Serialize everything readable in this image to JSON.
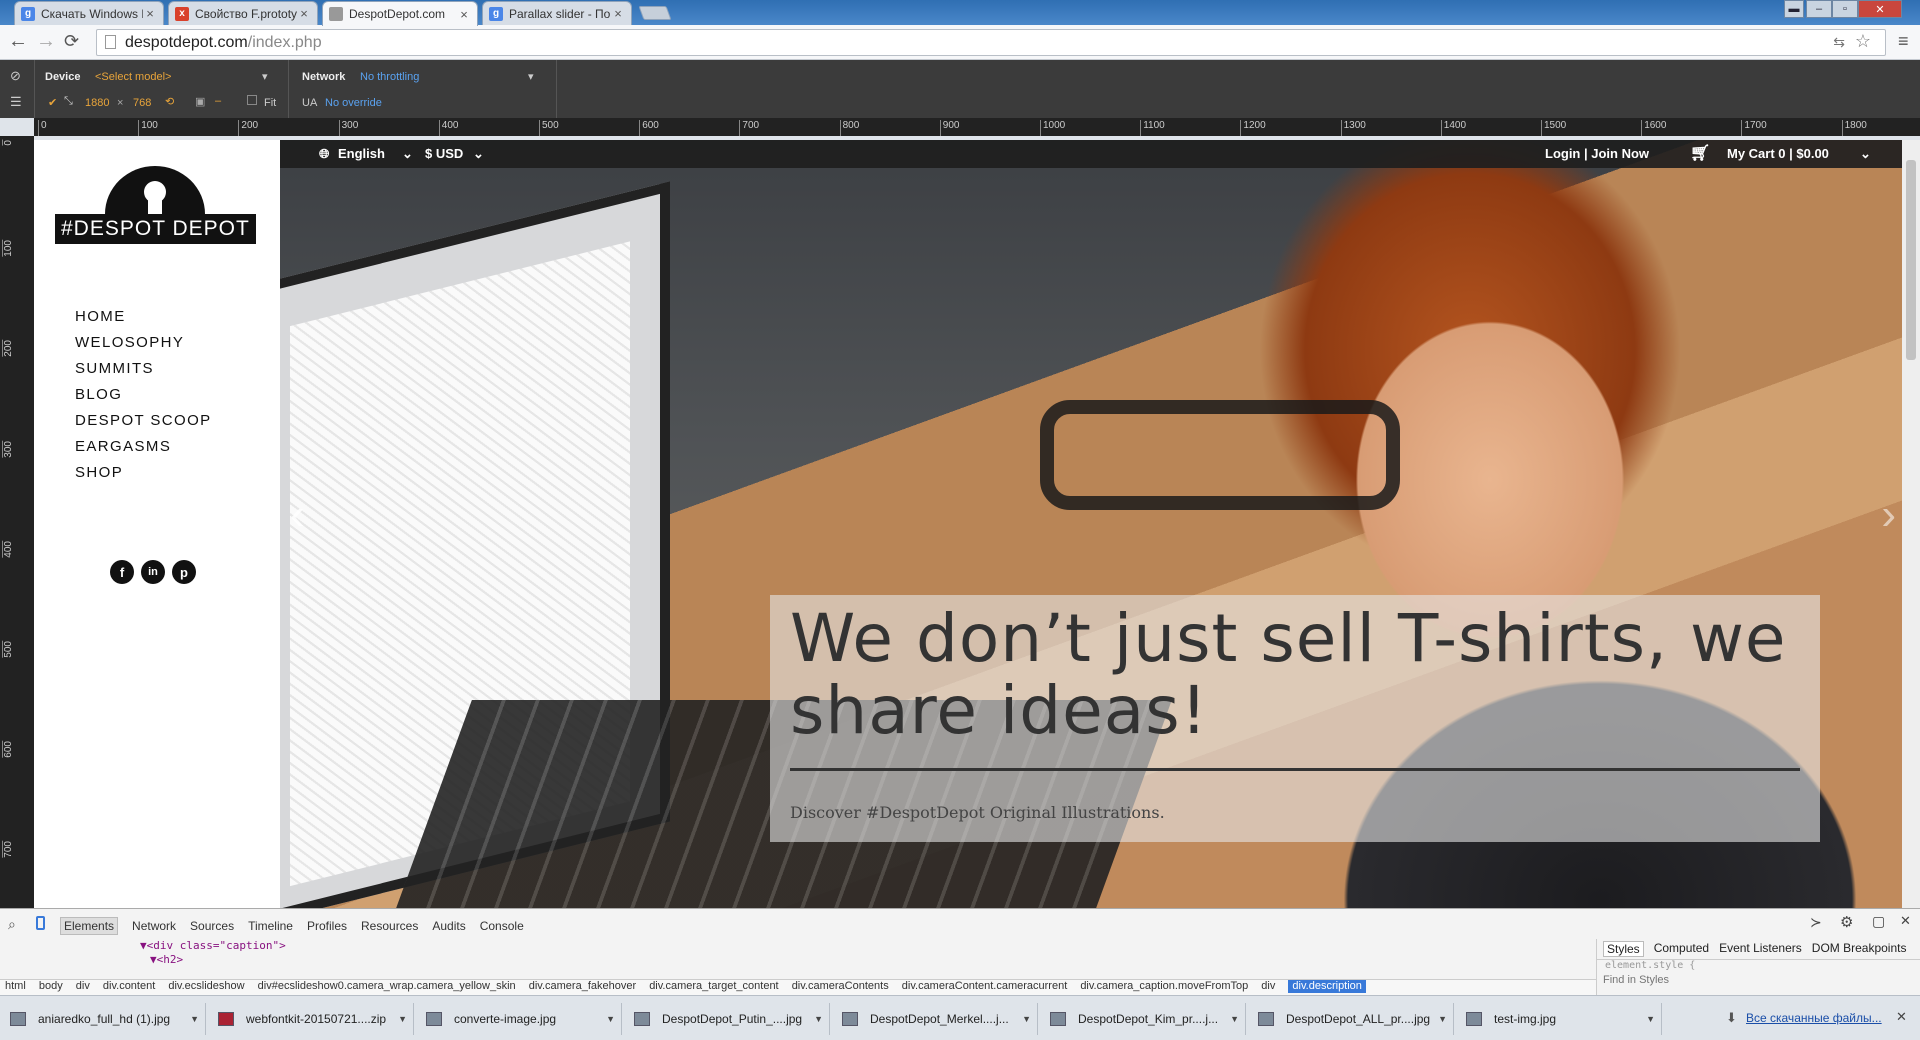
{
  "browser": {
    "tabs": [
      {
        "title": "Скачать Windows Phone",
        "icon": "google-icon",
        "color": "#4a86e8"
      },
      {
        "title": "Свойство F.prototype и с",
        "icon": "js-icon",
        "color": "#d9412b"
      },
      {
        "title": "DespotDepot.com",
        "icon": "page-icon",
        "color": "#888888",
        "active": true
      },
      {
        "title": "Parallax slider - Поиск в G",
        "icon": "google-icon",
        "color": "#4a86e8"
      }
    ],
    "url_host": "despotdepot.com",
    "url_path": "/index.php"
  },
  "device_bar": {
    "device_label": "Device",
    "model": "<Select model>",
    "width": "1880",
    "times": "×",
    "height": "768",
    "fit_label": "Fit",
    "network_label": "Network",
    "throttle": "No throttling",
    "ua_label": "UA",
    "ua_value": "No override"
  },
  "ruler_top": [
    "0",
    "100",
    "200",
    "300",
    "400",
    "500",
    "600",
    "700",
    "800",
    "900",
    "1000",
    "1100",
    "1200",
    "1300",
    "1400",
    "1500",
    "1600",
    "1700",
    "1800"
  ],
  "ruler_left": [
    "0",
    "100",
    "200",
    "300",
    "400",
    "500",
    "600",
    "700"
  ],
  "site": {
    "logo_text": "#DESPOT DEPOT",
    "nav": [
      "HOME",
      "WELOSOPHY",
      "SUMMITS",
      "BLOG",
      "DESPOT SCOOP",
      "EARGASMS",
      "SHOP"
    ],
    "social": [
      "f",
      "in",
      "p"
    ],
    "language": "English",
    "currency": "$ USD",
    "login": "Login | Join Now",
    "cart": "My Cart 0 | $0.00",
    "caption_title": "We don’t just sell T-shirts, we share ideas!",
    "caption_sub": "Discover #DespotDepot Original Illustrations."
  },
  "devtools": {
    "tabs": [
      "Elements",
      "Network",
      "Sources",
      "Timeline",
      "Profiles",
      "Resources",
      "Audits",
      "Console"
    ],
    "code_line1": "▼<div class=\"caption\">",
    "code_line2": "▼<h2>",
    "crumbs": [
      "html",
      "body",
      "div",
      "div.content",
      "div.ecslideshow",
      "div#ecslideshow0.camera_wrap.camera_yellow_skin",
      "div.camera_fakehover",
      "div.camera_target_content",
      "div.cameraContents",
      "div.cameraContent.cameracurrent",
      "div.camera_caption.moveFromTop",
      "div",
      "div.description"
    ],
    "side_tabs": [
      "Styles",
      "Computed",
      "Event Listeners",
      "DOM Breakpoints"
    ],
    "style_hint": "element.style {",
    "find_placeholder": "Find in Styles"
  },
  "downloads": {
    "items": [
      "aniaredko_full_hd (1).jpg",
      "webfontkit-20150721....zip",
      "converte-image.jpg",
      "DespotDepot_Putin_....jpg",
      "DespotDepot_Merkel....j...",
      "DespotDepot_Kim_pr....j...",
      "DespotDepot_ALL_pr....jpg",
      "test-img.jpg"
    ],
    "show_all": "Все скачанные файлы..."
  }
}
